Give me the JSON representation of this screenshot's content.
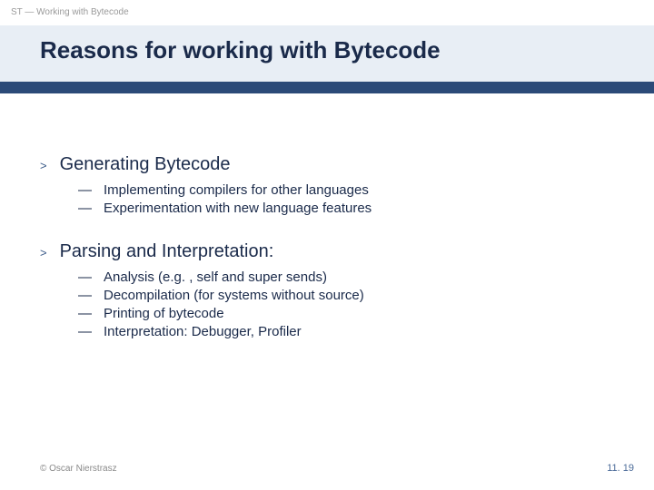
{
  "header_label": "ST — Working with Bytecode",
  "title": "Reasons for working with Bytecode",
  "sections": [
    {
      "heading": "Generating Bytecode",
      "items": [
        "Implementing compilers for other languages",
        "Experimentation with new language features"
      ]
    },
    {
      "heading": "Parsing and Interpretation:",
      "items": [
        "Analysis (e.g. , self and super sends)",
        "Decompilation (for systems without source)",
        "Printing of bytecode",
        "Interpretation: Debugger, Profiler"
      ]
    }
  ],
  "footer_left": "© Oscar Nierstrasz",
  "footer_right": "11. 19",
  "colors": {
    "band": "#e8eef5",
    "accent": "#2b4a78",
    "title": "#1a2a4a"
  }
}
